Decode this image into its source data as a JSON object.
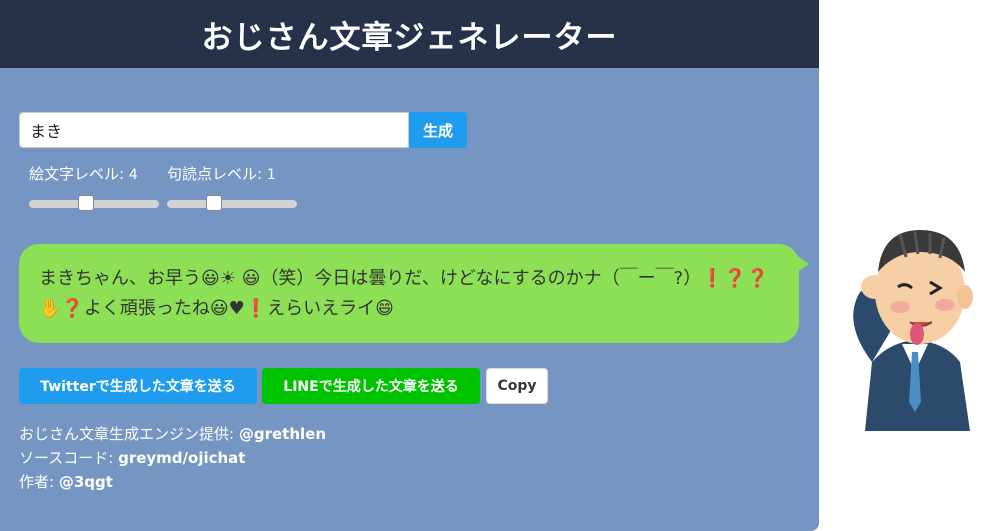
{
  "header": {
    "title": "おじさん文章ジェネレーター"
  },
  "form": {
    "name_value": "まき",
    "generate_label": "生成"
  },
  "levels": {
    "emoji": {
      "label": "絵文字レベル:",
      "value": "4",
      "fraction": 0.44
    },
    "punctuation": {
      "label": "句読点レベル:",
      "value": "1",
      "fraction": 0.36
    }
  },
  "message": {
    "text": "まきちゃん、お早う😃☀ 😃（笑）今日は曇りだ、けどなにするのかナ（￣ー￣?）❗❓❓✋❓よく頑張ったね😃♥❗えらいえライ😄"
  },
  "actions": {
    "twitter_label": "Twitterで生成した文章を送る",
    "line_label": "LINEで生成した文章を送る",
    "copy_label": "Copy"
  },
  "credits": {
    "engine_label": "おじさん文章生成エンジン提供:",
    "engine_link": "@grethlen",
    "source_label": "ソースコード:",
    "source_link": "greymd/ojichat",
    "author_label": "作者:",
    "author_link": "@3qgt"
  },
  "colors": {
    "header_bg": "#27324a",
    "page_bg": "#7595c2",
    "bubble_bg": "#8de055",
    "twitter": "#209cee",
    "line": "#00c300"
  }
}
